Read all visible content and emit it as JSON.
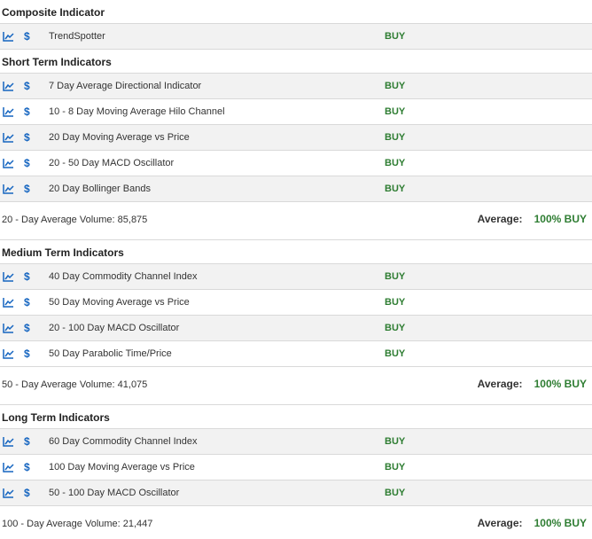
{
  "colors": {
    "buy": "#2e7d32",
    "icon": "#1565c0",
    "row_alt": "#f2f2f2",
    "divider": "#d9d9d9"
  },
  "icons": {
    "chart": "line-chart-icon",
    "dollar": "dollar-icon"
  },
  "composite": {
    "title": "Composite Indicator",
    "rows": [
      {
        "name": "TrendSpotter",
        "signal": "BUY"
      }
    ]
  },
  "short_term": {
    "title": "Short Term Indicators",
    "rows": [
      {
        "name": "7 Day Average Directional Indicator",
        "signal": "BUY"
      },
      {
        "name": "10 - 8 Day Moving Average Hilo Channel",
        "signal": "BUY"
      },
      {
        "name": "20 Day Moving Average vs Price",
        "signal": "BUY"
      },
      {
        "name": "20 - 50 Day MACD Oscillator",
        "signal": "BUY"
      },
      {
        "name": "20 Day Bollinger Bands",
        "signal": "BUY"
      }
    ],
    "volume": "20 - Day Average Volume: 85,875",
    "average_label": "Average:",
    "average_value": "100% BUY"
  },
  "medium_term": {
    "title": "Medium Term Indicators",
    "rows": [
      {
        "name": "40 Day Commodity Channel Index",
        "signal": "BUY"
      },
      {
        "name": "50 Day Moving Average vs Price",
        "signal": "BUY"
      },
      {
        "name": "20 - 100 Day MACD Oscillator",
        "signal": "BUY"
      },
      {
        "name": "50 Day Parabolic Time/Price",
        "signal": "BUY"
      }
    ],
    "volume": "50 - Day Average Volume: 41,075",
    "average_label": "Average:",
    "average_value": "100% BUY"
  },
  "long_term": {
    "title": "Long Term Indicators",
    "rows": [
      {
        "name": "60 Day Commodity Channel Index",
        "signal": "BUY"
      },
      {
        "name": "100 Day Moving Average vs Price",
        "signal": "BUY"
      },
      {
        "name": "50 - 100 Day MACD Oscillator",
        "signal": "BUY"
      }
    ],
    "volume": "100 - Day Average Volume: 21,447",
    "average_label": "Average:",
    "average_value": "100% BUY"
  }
}
